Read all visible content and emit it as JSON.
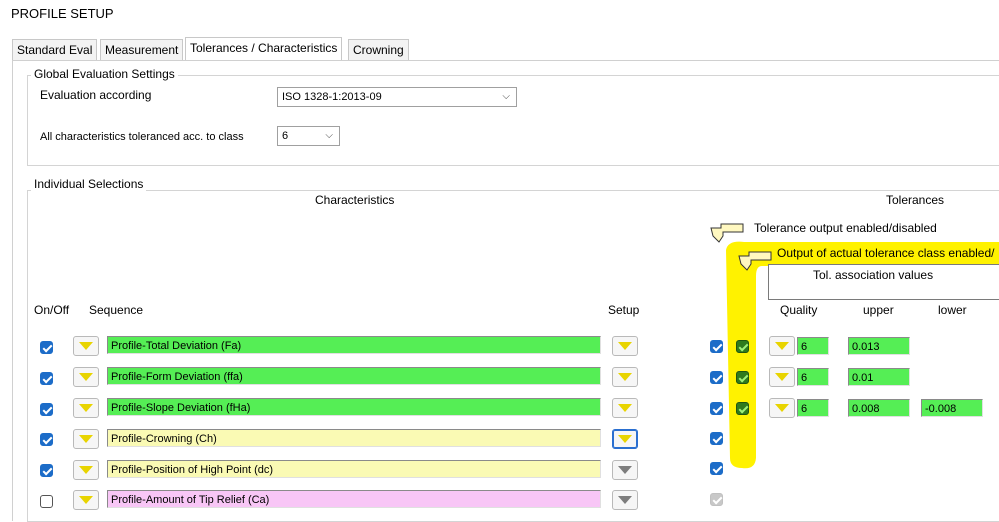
{
  "window": {
    "title": "PROFILE SETUP"
  },
  "tabs": [
    {
      "label": "Standard Eval",
      "active": false
    },
    {
      "label": "Measurement",
      "active": false
    },
    {
      "label": "Tolerances / Characteristics",
      "active": true
    },
    {
      "label": "Crowning",
      "active": false
    }
  ],
  "global": {
    "legend": "Global Evaluation Settings",
    "evaluation_label": "Evaluation according",
    "evaluation_value": "ISO 1328-1:2013-09",
    "class_label": "All characteristics toleranced acc. to class",
    "class_value": "6"
  },
  "individual": {
    "legend": "Individual Selections",
    "characteristics_header": "Characteristics",
    "tolerances_header": "Tolerances",
    "tol_output_label": "Tolerance output enabled/disabled",
    "actual_class_label": "Output of actual tolerance class enabled/",
    "tol_assoc_label": "Tol. association values",
    "col_onoff": "On/Off",
    "col_sequence": "Sequence",
    "col_setup": "Setup",
    "col_quality": "Quality",
    "col_upper": "upper",
    "col_lower": "lower"
  },
  "rows": [
    {
      "name": "Profile-Total Deviation (Fa)",
      "on": true,
      "color": "green",
      "setup": "yellow",
      "tol": "on",
      "actual": true,
      "quality": "6",
      "upper": "0.013",
      "lower": ""
    },
    {
      "name": "Profile-Form Deviation (ffa)",
      "on": true,
      "color": "green",
      "setup": "yellow",
      "tol": "on",
      "actual": true,
      "quality": "6",
      "upper": "0.01",
      "lower": ""
    },
    {
      "name": "Profile-Slope Deviation (fHa)",
      "on": true,
      "color": "green",
      "setup": "yellow",
      "tol": "on",
      "actual": true,
      "quality": "6",
      "upper": "0.008",
      "lower": "-0.008"
    },
    {
      "name": "Profile-Crowning (Ch)",
      "on": true,
      "color": "cream",
      "setup": "yellow-focused",
      "tol": "on",
      "actual": false
    },
    {
      "name": "Profile-Position of High Point (dc)",
      "on": true,
      "color": "cream",
      "setup": "gray",
      "tol": "on",
      "actual": false
    },
    {
      "name": "Profile-Amount of Tip Relief (Ca)",
      "on": false,
      "color": "pink",
      "setup": "gray",
      "tol": "disabled",
      "actual": false
    }
  ],
  "colors": {
    "accent": "#1c6cc8",
    "highlight": "#fff200",
    "green_field": "#55ee55",
    "cream_field": "#fafab4",
    "pink_field": "#f8c6f6"
  },
  "icons": {
    "sequence": "yellow-down-triangle-icon",
    "pointer": "pointing-hand-icon",
    "dropdown": "chevron-down-icon"
  }
}
